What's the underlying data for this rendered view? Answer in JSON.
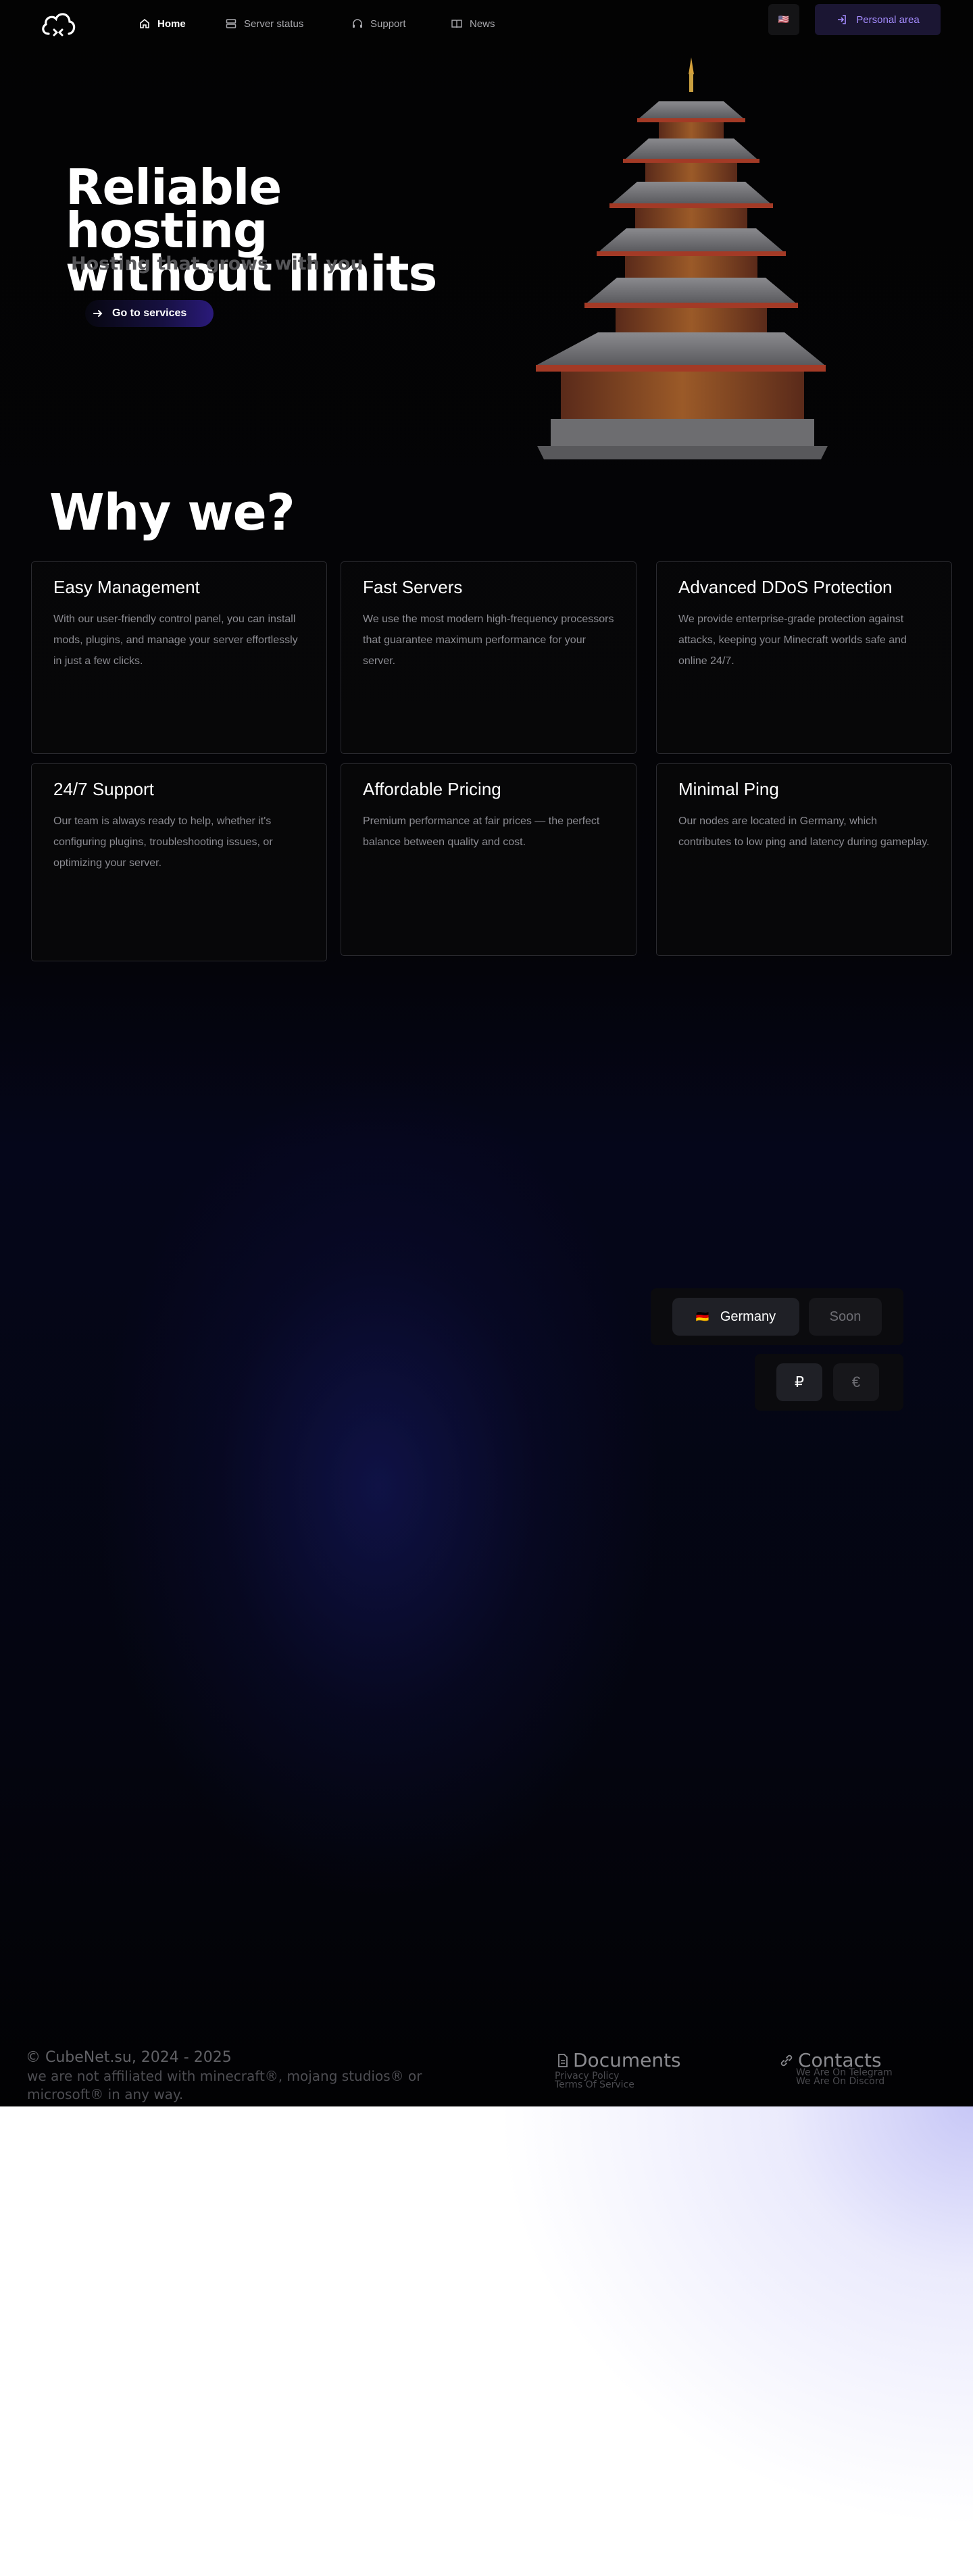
{
  "nav": {
    "items": [
      {
        "label": "Home",
        "icon": "home-icon",
        "active": true
      },
      {
        "label": "Server status",
        "icon": "server-icon"
      },
      {
        "label": "Support",
        "icon": "headset-icon"
      },
      {
        "label": "News",
        "icon": "book-icon"
      }
    ],
    "language_flag": "🇺🇸",
    "personal_area_label": "Personal area"
  },
  "hero": {
    "title_line1": "Reliable hosting",
    "title_line2": "without limits",
    "subtitle": "Hosting that grows with you",
    "cta_label": "Go to services"
  },
  "why": {
    "title": "Why we?",
    "cards": [
      {
        "title": "Easy Management",
        "text": "With our user-friendly control panel, you can install mods, plugins, and manage your server effortlessly in just a few clicks."
      },
      {
        "title": "Fast Servers",
        "text": "We use the most modern high-frequency processors that guarantee maximum performance for your server."
      },
      {
        "title": "Advanced DDoS Protection",
        "text": "We provide enterprise-grade protection against attacks, keeping your Minecraft worlds safe and online 24/7."
      },
      {
        "title": "24/7 Support",
        "text": "Our team is always ready to help, whether it's configuring plugins, troubleshooting issues, or optimizing your server."
      },
      {
        "title": "Affordable Pricing",
        "text": "Premium performance at fair prices — the perfect balance between quality and cost."
      },
      {
        "title": "Minimal Ping",
        "text": "Our nodes are located in Germany, which contributes to low ping and latency during gameplay."
      }
    ]
  },
  "locations": {
    "active": "Germany",
    "active_flag": "🇩🇪",
    "soon": "Soon"
  },
  "currency": {
    "options": [
      "₽",
      "€"
    ],
    "selected": "₽"
  },
  "footer": {
    "copyright": "© CubeNet.su, 2024 - 2025",
    "disclaimer": "we are not affiliated with minecraft®, mojang studios® or microsoft® in any way.",
    "documents_title": "Documents",
    "documents_links": [
      "Privacy Policy",
      "Terms Of Service"
    ],
    "contacts_title": "Contacts",
    "contacts_links": [
      "We Are On Telegram",
      "We Are On Discord"
    ]
  },
  "colors": {
    "accent": "#a58cff",
    "background": "#030303"
  }
}
